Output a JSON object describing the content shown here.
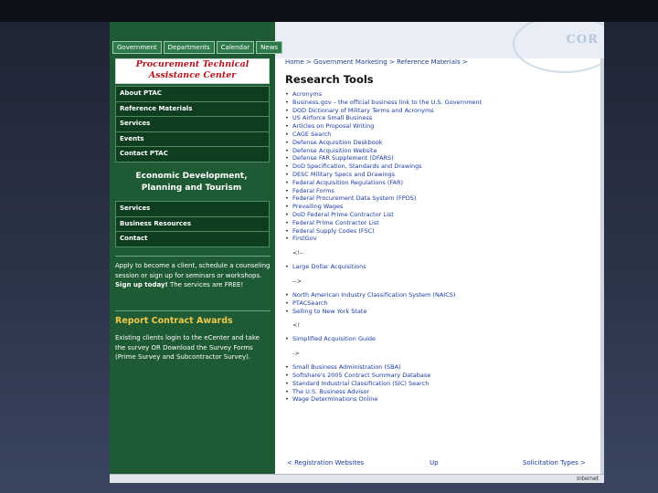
{
  "tabs": [
    "Government",
    "Departments",
    "Calendar",
    "News"
  ],
  "seal_text": "COR",
  "ptac_logo": [
    "Procurement Technical",
    "Assistance Center"
  ],
  "ptac_nav": [
    "About PTAC",
    "Reference Materials",
    "Services",
    "Events",
    "Contact PTAC"
  ],
  "econ_logo": [
    "Economic Development,",
    "Planning and Tourism"
  ],
  "econ_nav": [
    "Services",
    "Business Resources",
    "Contact"
  ],
  "apply_text": {
    "before": "Apply to become a client, schedule a counseling session or sign up for seminars or workshops. ",
    "bold": "Sign up today!",
    "after": " The services are FREE!"
  },
  "report": {
    "title": "Report Contract Awards",
    "before": "Existing clients login to the eCenter and take the survey OR Download the Survey Forms (Prime Survey and Subcontractor Survey)."
  },
  "breadcrumb": "Home > Government Marketing > Reference Materials >",
  "page_title": "Research Tools",
  "links_1": [
    "Acronyms",
    "Business.gov – the official business link to the U.S. Government",
    "DOD Dictionary of Military Terms and Acronyms",
    "US Airforce Small Business",
    "Articles on Proposal Writing",
    "CAGE Search",
    "Defense Acquisition Deskbook",
    "Defense Acquisition Website",
    "Defense FAR Supplement (DFARS)",
    "DoD Specification, Standards and Drawings",
    "DESC Military Specs and Drawings",
    "Federal Acquisition Regulations (FAR)",
    "Federal Forms",
    "Federal Procurement Data System (FPDS)",
    "Prevailing Wages",
    "DoD Federal Prime Contractor List",
    "Federal Prime Contractor List",
    "Federal Supply Codes (FSC)",
    "FirstGov"
  ],
  "gap_1": "<!--",
  "links_2": [
    "Large Dollar Acquisitions"
  ],
  "gap_2": "-->",
  "links_3": [
    "North American Industry Classification System (NAICS)",
    "PTACSearch",
    "Selling to New York State"
  ],
  "gap_3": "<!",
  "links_4": [
    "Simplified Acquisition Guide"
  ],
  "gap_4": "->",
  "links_5": [
    "Small Business Administration (SBA)",
    "Softshare's 2005 Contract Summary Database",
    "Standard Industrial Classification (SIC) Search",
    "The U.S. Business Advisor",
    "Wage Determinations Online"
  ],
  "bottom_nav": {
    "left": "< Registration Websites",
    "middle": "Up",
    "right": "Solicitation Types >"
  },
  "status_text": "Internet"
}
